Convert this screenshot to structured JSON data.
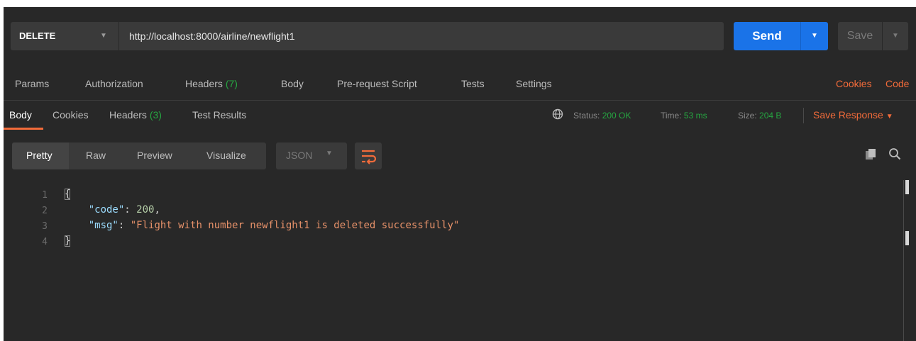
{
  "request": {
    "method": "DELETE",
    "url": "http://localhost:8000/airline/newflight1",
    "send_label": "Send",
    "save_label": "Save"
  },
  "request_tabs": {
    "params": "Params",
    "authorization": "Authorization",
    "headers": "Headers",
    "headers_count": "(7)",
    "body": "Body",
    "prerequest": "Pre-request Script",
    "tests": "Tests",
    "settings": "Settings",
    "cookies": "Cookies",
    "code": "Code"
  },
  "response_tabs": {
    "body": "Body",
    "cookies": "Cookies",
    "headers": "Headers",
    "headers_count": "(3)",
    "test_results": "Test Results"
  },
  "response_meta": {
    "status_label": "Status:",
    "status_value": "200 OK",
    "time_label": "Time:",
    "time_value": "53 ms",
    "size_label": "Size:",
    "size_value": "204 B",
    "save_response": "Save Response"
  },
  "viewer": {
    "pretty": "Pretty",
    "raw": "Raw",
    "preview": "Preview",
    "visualize": "Visualize",
    "format": "JSON"
  },
  "code": {
    "line_numbers": [
      "1",
      "2",
      "3",
      "4"
    ],
    "open_brace": "{",
    "close_brace": "}",
    "key_code": "\"code\"",
    "val_code": "200",
    "key_msg": "\"msg\"",
    "val_msg": "\"Flight with number newflight1 is deleted successfully\""
  },
  "colors": {
    "accent_orange": "#f26b3a",
    "send_blue": "#1a73e8",
    "status_green": "#26a641",
    "background": "#282828"
  },
  "icons": [
    "chevron-down-icon",
    "globe-icon",
    "wrap-lines-icon",
    "copy-icon",
    "search-icon"
  ]
}
